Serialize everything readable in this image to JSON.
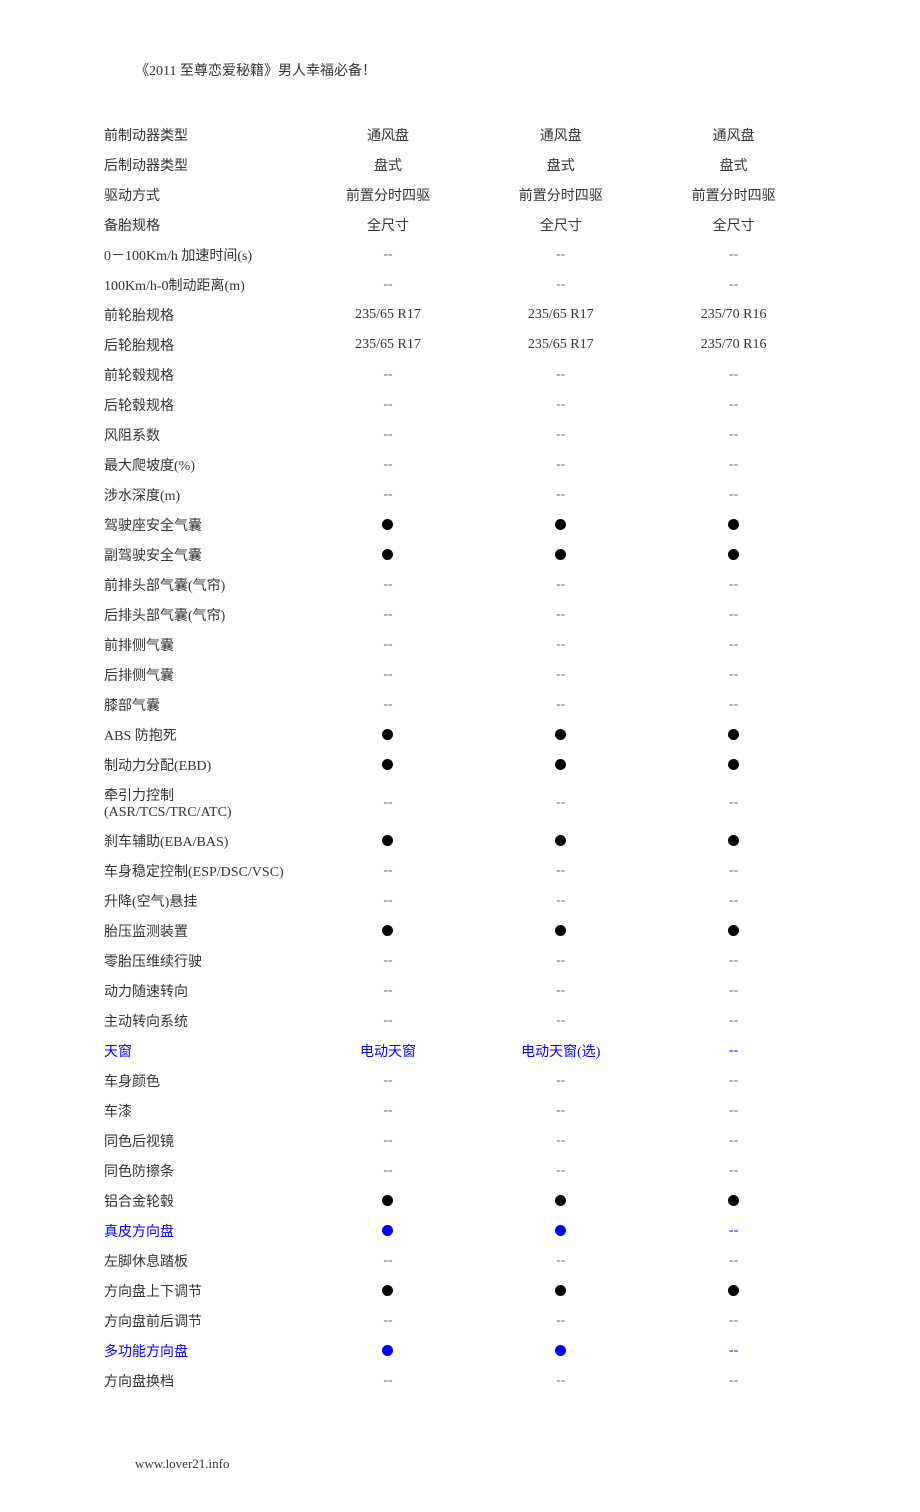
{
  "header": "《2011 至尊恋爱秘籍》男人幸福必备！",
  "footer": "www.lover21.info",
  "rows": [
    {
      "label": "前制动器类型",
      "cells": [
        {
          "t": "text",
          "v": "通风盘"
        },
        {
          "t": "text",
          "v": "通风盘"
        },
        {
          "t": "text",
          "v": "通风盘"
        }
      ]
    },
    {
      "label": "后制动器类型",
      "cells": [
        {
          "t": "text",
          "v": "盘式"
        },
        {
          "t": "text",
          "v": "盘式"
        },
        {
          "t": "text",
          "v": "盘式"
        }
      ]
    },
    {
      "label": "驱动方式",
      "cells": [
        {
          "t": "text",
          "v": "前置分时四驱"
        },
        {
          "t": "text",
          "v": "前置分时四驱"
        },
        {
          "t": "text",
          "v": "前置分时四驱"
        }
      ]
    },
    {
      "label": "备胎规格",
      "cells": [
        {
          "t": "text",
          "v": "全尺寸"
        },
        {
          "t": "text",
          "v": "全尺寸"
        },
        {
          "t": "text",
          "v": "全尺寸"
        }
      ]
    },
    {
      "label": "0－100Km/h 加速时间(s)",
      "cells": [
        {
          "t": "dash"
        },
        {
          "t": "dash"
        },
        {
          "t": "dash"
        }
      ]
    },
    {
      "label": "100Km/h-0制动距离(m)",
      "cells": [
        {
          "t": "dash"
        },
        {
          "t": "dash"
        },
        {
          "t": "dash"
        }
      ]
    },
    {
      "label": "前轮胎规格",
      "cells": [
        {
          "t": "text",
          "v": "235/65 R17"
        },
        {
          "t": "text",
          "v": "235/65 R17"
        },
        {
          "t": "text",
          "v": "235/70 R16"
        }
      ]
    },
    {
      "label": "后轮胎规格",
      "cells": [
        {
          "t": "text",
          "v": "235/65 R17"
        },
        {
          "t": "text",
          "v": "235/65 R17"
        },
        {
          "t": "text",
          "v": "235/70 R16"
        }
      ]
    },
    {
      "label": "前轮毂规格",
      "cells": [
        {
          "t": "dash"
        },
        {
          "t": "dash"
        },
        {
          "t": "dash"
        }
      ]
    },
    {
      "label": "后轮毂规格",
      "cells": [
        {
          "t": "dash"
        },
        {
          "t": "dash"
        },
        {
          "t": "dash"
        }
      ]
    },
    {
      "label": "风阻系数",
      "cells": [
        {
          "t": "dash"
        },
        {
          "t": "dash"
        },
        {
          "t": "dash"
        }
      ]
    },
    {
      "label": "最大爬坡度(%)",
      "cells": [
        {
          "t": "dash"
        },
        {
          "t": "dash"
        },
        {
          "t": "dash"
        }
      ]
    },
    {
      "label": "涉水深度(m)",
      "cells": [
        {
          "t": "dash"
        },
        {
          "t": "dash"
        },
        {
          "t": "dash"
        }
      ]
    },
    {
      "label": "驾驶座安全气囊",
      "cells": [
        {
          "t": "dot"
        },
        {
          "t": "dot"
        },
        {
          "t": "dot"
        }
      ]
    },
    {
      "label": "副驾驶安全气囊",
      "cells": [
        {
          "t": "dot"
        },
        {
          "t": "dot"
        },
        {
          "t": "dot"
        }
      ]
    },
    {
      "label": "前排头部气囊(气帘)",
      "cells": [
        {
          "t": "dash"
        },
        {
          "t": "dash"
        },
        {
          "t": "dash"
        }
      ]
    },
    {
      "label": "后排头部气囊(气帘)",
      "cells": [
        {
          "t": "dash"
        },
        {
          "t": "dash"
        },
        {
          "t": "dash"
        }
      ]
    },
    {
      "label": "前排侧气囊",
      "cells": [
        {
          "t": "dash"
        },
        {
          "t": "dash"
        },
        {
          "t": "dash"
        }
      ]
    },
    {
      "label": "后排侧气囊",
      "cells": [
        {
          "t": "dash"
        },
        {
          "t": "dash"
        },
        {
          "t": "dash"
        }
      ]
    },
    {
      "label": "膝部气囊",
      "cells": [
        {
          "t": "dash"
        },
        {
          "t": "dash"
        },
        {
          "t": "dash"
        }
      ]
    },
    {
      "label": "ABS 防抱死",
      "cells": [
        {
          "t": "dot"
        },
        {
          "t": "dot"
        },
        {
          "t": "dot"
        }
      ]
    },
    {
      "label": "制动力分配(EBD)",
      "cells": [
        {
          "t": "dot"
        },
        {
          "t": "dot"
        },
        {
          "t": "dot"
        }
      ]
    },
    {
      "label": "牵引力控制(ASR/TCS/TRC/ATC)",
      "cells": [
        {
          "t": "dash"
        },
        {
          "t": "dash"
        },
        {
          "t": "dash"
        }
      ]
    },
    {
      "label": "刹车辅助(EBA/BAS)",
      "cells": [
        {
          "t": "dot"
        },
        {
          "t": "dot"
        },
        {
          "t": "dot"
        }
      ]
    },
    {
      "label": "车身稳定控制(ESP/DSC/VSC)",
      "cells": [
        {
          "t": "dash"
        },
        {
          "t": "dash"
        },
        {
          "t": "dash"
        }
      ]
    },
    {
      "label": "升降(空气)悬挂",
      "cells": [
        {
          "t": "dash"
        },
        {
          "t": "dash"
        },
        {
          "t": "dash"
        }
      ]
    },
    {
      "label": "胎压监测装置",
      "cells": [
        {
          "t": "dot"
        },
        {
          "t": "dot"
        },
        {
          "t": "dot"
        }
      ]
    },
    {
      "label": "零胎压维续行驶",
      "cells": [
        {
          "t": "dash"
        },
        {
          "t": "dash"
        },
        {
          "t": "dash"
        }
      ]
    },
    {
      "label": "动力随速转向",
      "cells": [
        {
          "t": "dash"
        },
        {
          "t": "dash"
        },
        {
          "t": "dash"
        }
      ]
    },
    {
      "label": "主动转向系统",
      "cells": [
        {
          "t": "dash"
        },
        {
          "t": "dash"
        },
        {
          "t": "dash"
        }
      ]
    },
    {
      "label": "天窗",
      "labelBlue": true,
      "cells": [
        {
          "t": "bluetext",
          "v": "电动天窗"
        },
        {
          "t": "bluetext",
          "v": "电动天窗(选)"
        },
        {
          "t": "bluedash"
        }
      ]
    },
    {
      "label": "车身颜色",
      "cells": [
        {
          "t": "dash"
        },
        {
          "t": "dash"
        },
        {
          "t": "dash"
        }
      ]
    },
    {
      "label": "车漆",
      "cells": [
        {
          "t": "dash"
        },
        {
          "t": "dash"
        },
        {
          "t": "dash"
        }
      ]
    },
    {
      "label": "同色后视镜",
      "cells": [
        {
          "t": "dash"
        },
        {
          "t": "dash"
        },
        {
          "t": "dash"
        }
      ]
    },
    {
      "label": "同色防擦条",
      "cells": [
        {
          "t": "dash"
        },
        {
          "t": "dash"
        },
        {
          "t": "dash"
        }
      ]
    },
    {
      "label": "铝合金轮毂",
      "cells": [
        {
          "t": "dot"
        },
        {
          "t": "dot"
        },
        {
          "t": "dot"
        }
      ]
    },
    {
      "label": "真皮方向盘",
      "labelBlue": true,
      "cells": [
        {
          "t": "bluedot"
        },
        {
          "t": "bluedot"
        },
        {
          "t": "bluedash"
        }
      ]
    },
    {
      "label": "左脚休息踏板",
      "cells": [
        {
          "t": "dash"
        },
        {
          "t": "dash"
        },
        {
          "t": "dash"
        }
      ]
    },
    {
      "label": "方向盘上下调节",
      "cells": [
        {
          "t": "dot"
        },
        {
          "t": "dot"
        },
        {
          "t": "dot"
        }
      ]
    },
    {
      "label": "方向盘前后调节",
      "cells": [
        {
          "t": "dash"
        },
        {
          "t": "dash"
        },
        {
          "t": "dash"
        }
      ]
    },
    {
      "label": "多功能方向盘",
      "labelBlue": true,
      "cells": [
        {
          "t": "bluedot"
        },
        {
          "t": "bluedot"
        },
        {
          "t": "bluedash"
        }
      ]
    },
    {
      "label": "方向盘换档",
      "cells": [
        {
          "t": "dash"
        },
        {
          "t": "dash"
        },
        {
          "t": "dash"
        }
      ]
    }
  ]
}
